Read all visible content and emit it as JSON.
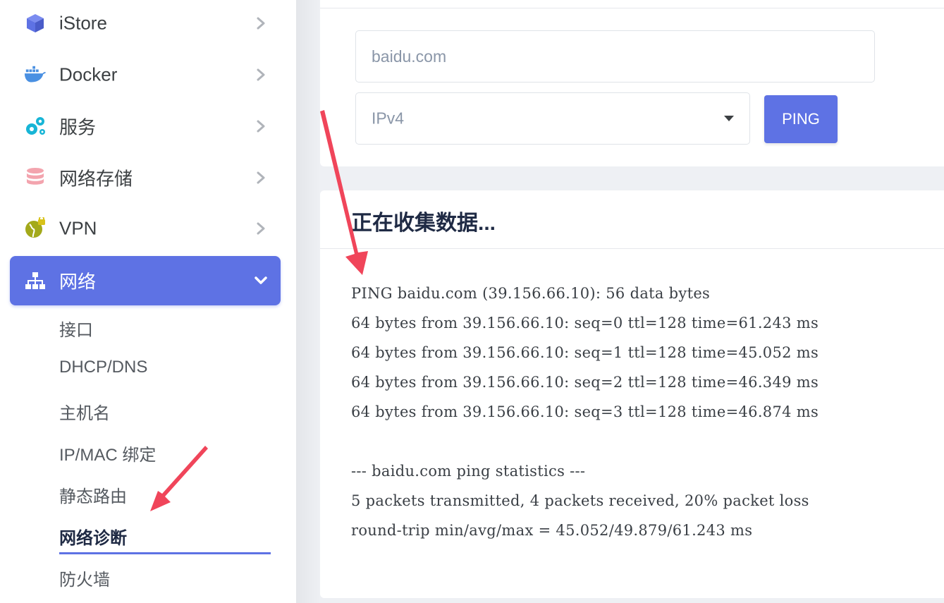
{
  "sidebar": {
    "items": [
      {
        "label": "iStore",
        "icon": "cube-icon"
      },
      {
        "label": "Docker",
        "icon": "docker-whale-icon"
      },
      {
        "label": "服务",
        "icon": "gears-icon"
      },
      {
        "label": "网络存储",
        "icon": "database-icon"
      },
      {
        "label": "VPN",
        "icon": "globe-lock-icon"
      },
      {
        "label": "网络",
        "icon": "sitemap-icon",
        "expanded": true
      }
    ],
    "subitems": [
      {
        "label": "接口"
      },
      {
        "label": "DHCP/DNS"
      },
      {
        "label": "主机名"
      },
      {
        "label": "IP/MAC 绑定"
      },
      {
        "label": "静态路由"
      },
      {
        "label": "网络诊断",
        "current": true
      },
      {
        "label": "防火墙"
      }
    ]
  },
  "diagnostics": {
    "host_placeholder": "baidu.com",
    "protocol": "IPv4",
    "ping_label": "PING"
  },
  "result": {
    "title": "正在收集数据...",
    "lines": [
      "PING baidu.com (39.156.66.10): 56 data bytes",
      "64 bytes from 39.156.66.10: seq=0 ttl=128 time=61.243 ms",
      "64 bytes from 39.156.66.10: seq=1 ttl=128 time=45.052 ms",
      "64 bytes from 39.156.66.10: seq=2 ttl=128 time=46.349 ms",
      "64 bytes from 39.156.66.10: seq=3 ttl=128 time=46.874 ms",
      "",
      "--- baidu.com ping statistics ---",
      "5 packets transmitted, 4 packets received, 20% packet loss",
      "round-trip min/avg/max = 45.052/49.879/61.243 ms"
    ]
  },
  "colors": {
    "accent": "#5e72e4",
    "annotation_arrow": "#f0455a"
  }
}
